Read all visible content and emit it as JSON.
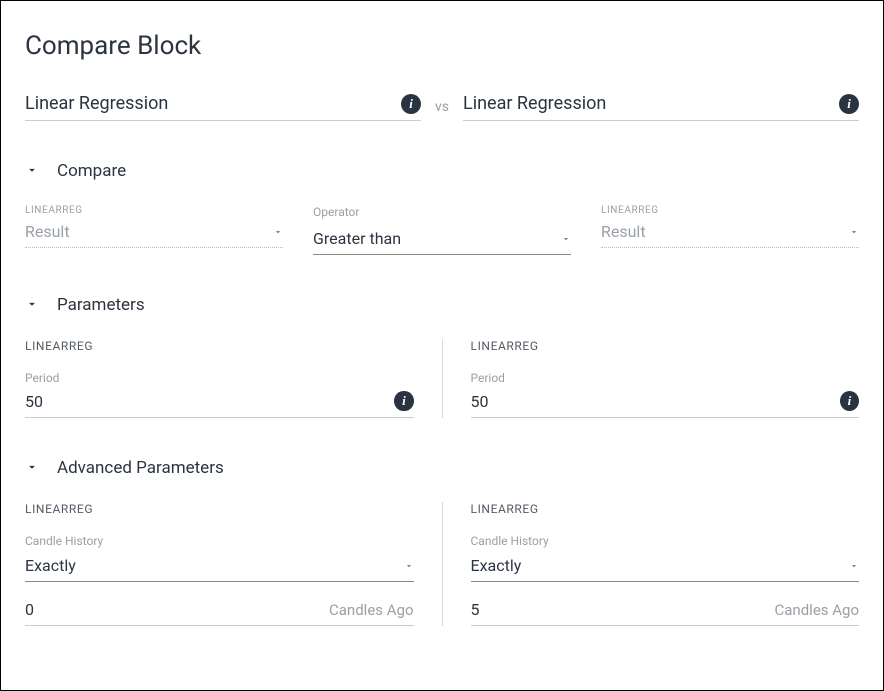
{
  "title": "Compare Block",
  "indicator_left": {
    "name": "Linear Regression"
  },
  "indicator_right": {
    "name": "Linear Regression"
  },
  "vs_label": "vs",
  "sections": {
    "compare": {
      "title": "Compare",
      "left": {
        "heading": "LINEARREG",
        "result_label": "Result"
      },
      "operator": {
        "label": "Operator",
        "value": "Greater than"
      },
      "right": {
        "heading": "LINEARREG",
        "result_label": "Result"
      }
    },
    "parameters": {
      "title": "Parameters",
      "left": {
        "heading": "LINEARREG",
        "period_label": "Period",
        "period_value": "50"
      },
      "right": {
        "heading": "LINEARREG",
        "period_label": "Period",
        "period_value": "50"
      }
    },
    "advanced": {
      "title": "Advanced Parameters",
      "left": {
        "heading": "LINEARREG",
        "candle_history_label": "Candle History",
        "candle_history_value": "Exactly",
        "candles_ago_value": "0",
        "candles_ago_suffix": "Candles Ago"
      },
      "right": {
        "heading": "LINEARREG",
        "candle_history_label": "Candle History",
        "candle_history_value": "Exactly",
        "candles_ago_value": "5",
        "candles_ago_suffix": "Candles Ago"
      }
    }
  }
}
